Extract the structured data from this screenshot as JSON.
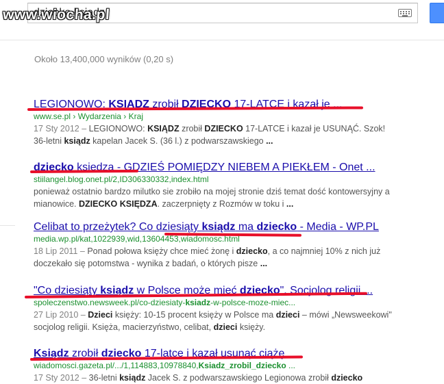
{
  "search": {
    "query": "dziecko ksiądz"
  },
  "watermark": {
    "text": "www.wiocha.pl"
  },
  "stats": {
    "text": "Około 13,400,000 wyników (0,20 s)"
  },
  "colors": {
    "link": "#1a0dab",
    "url_green": "#1a8f2e",
    "snippet_gray": "#545454",
    "accent_red": "#e8102a",
    "search_blue": "#4d90fe"
  },
  "icons": {
    "keyboard": "keyboard-icon",
    "search": "search-icon"
  },
  "results": [
    {
      "title": [
        {
          "t": "LEGIONOWO: ",
          "b": false
        },
        {
          "t": "KSIĄDZ",
          "b": true
        },
        {
          "t": " zrobił ",
          "b": false
        },
        {
          "t": "DZIECKO",
          "b": true
        },
        {
          "t": " 17-LATCE i kazał je ...",
          "b": false
        }
      ],
      "url": [
        {
          "t": "www.se.pl",
          "sep": false
        },
        {
          "t": " › ",
          "sep": true
        },
        {
          "t": "Wydarzenia",
          "sep": false
        },
        {
          "t": " › ",
          "sep": true
        },
        {
          "t": "Kraj",
          "sep": false
        }
      ],
      "snippet": [
        {
          "t": "17 Sty 2012 – ",
          "c": "date"
        },
        {
          "t": "LEGIONOWO: ",
          "c": ""
        },
        {
          "t": "KSIĄDZ",
          "c": "b"
        },
        {
          "t": " zrobił ",
          "c": ""
        },
        {
          "t": "DZIECKO",
          "c": "b"
        },
        {
          "t": " 17-LATCE i kazał je USUNĄĆ. Szok! 36-letni ",
          "c": ""
        },
        {
          "t": "ksiądz",
          "c": "b"
        },
        {
          "t": " kapelan Jacek S. (36 l.) z podwarszawskiego ",
          "c": ""
        },
        {
          "t": "...",
          "c": "b"
        }
      ]
    },
    {
      "title": [
        {
          "t": "dziecko",
          "b": true
        },
        {
          "t": " ksiedza - GDZIEŚ POMIĘDZY NIEBEM A PIEKŁEM - Onet ...",
          "b": false
        }
      ],
      "url": [
        {
          "t": "stiilangel.blog.onet.pl/2,ID306330332,index.html",
          "sep": false
        }
      ],
      "snippet": [
        {
          "t": "ponieważ ostatnio bardzo milutko sie zrobiło na mojej stronie dziś temat dość kontowersyjny a mianowice. ",
          "c": ""
        },
        {
          "t": "DZIECKO",
          "c": "b"
        },
        {
          "t": " ",
          "c": ""
        },
        {
          "t": "KSIĘDZA",
          "c": "b"
        },
        {
          "t": ". zaczerpnięty z Rozmów w toku i ",
          "c": ""
        },
        {
          "t": "...",
          "c": "b"
        }
      ]
    },
    {
      "title": [
        {
          "t": "Celibat to przeżytek? Co dziesiąty ",
          "b": false
        },
        {
          "t": "ksiądz",
          "b": true
        },
        {
          "t": " ma ",
          "b": false
        },
        {
          "t": "dziecko",
          "b": true
        },
        {
          "t": " - Media - WP.PL",
          "b": false
        }
      ],
      "url": [
        {
          "t": "media.wp.pl/kat,1022939,wid,13604453,wiadomosc.html",
          "sep": false
        }
      ],
      "snippet": [
        {
          "t": "18 Lip 2011 – ",
          "c": "date"
        },
        {
          "t": "Ponad połowa księży chce mieć żonę i ",
          "c": ""
        },
        {
          "t": "dziecko",
          "c": "b"
        },
        {
          "t": ", a co najmniej 10% z nich już doczekało się potomstwa - wynika z badań, o których pisze ",
          "c": ""
        },
        {
          "t": "...",
          "c": "b"
        }
      ]
    },
    {
      "title": [
        {
          "t": "\"Co dziesiąty ",
          "b": false
        },
        {
          "t": "ksiądz",
          "b": true
        },
        {
          "t": " w Polsce może mieć ",
          "b": false
        },
        {
          "t": "dziecko",
          "b": true
        },
        {
          "t": "\". Socjolog religii ...",
          "b": false
        }
      ],
      "url": [
        {
          "t": "spoleczenstwo.newsweek.pl/co-dziesiaty-",
          "sep": false
        },
        {
          "t": "ksiadz",
          "sep": false,
          "b": true
        },
        {
          "t": "-w-polsce-moze-miec...",
          "sep": false
        }
      ],
      "snippet": [
        {
          "t": "27 Lip 2010 – ",
          "c": "date"
        },
        {
          "t": "Dzieci",
          "c": "b"
        },
        {
          "t": " księży: 10-15 procent księży w Polsce ma ",
          "c": ""
        },
        {
          "t": "dzieci",
          "c": "b"
        },
        {
          "t": " – mówi „Newsweekowi\" socjolog religii. Księża, macierzyństwo, celibat, ",
          "c": ""
        },
        {
          "t": "dzieci",
          "c": "b"
        },
        {
          "t": " księży.",
          "c": ""
        }
      ]
    },
    {
      "title": [
        {
          "t": "Ksiądz",
          "b": true
        },
        {
          "t": " zrobił ",
          "b": false
        },
        {
          "t": "dziecko",
          "b": true
        },
        {
          "t": " 17-latce i kazał usunąć ciążę",
          "b": false
        }
      ],
      "url": [
        {
          "t": "wiadomosci.gazeta.pl/.../1,114883,10978840,",
          "sep": false
        },
        {
          "t": "Ksiadz_zrobil_dziecko",
          "sep": false,
          "b": true
        },
        {
          "t": " ...",
          "sep": false
        }
      ],
      "snippet": [
        {
          "t": "17 Sty 2012 – ",
          "c": "date"
        },
        {
          "t": "36-letni ",
          "c": ""
        },
        {
          "t": "ksiądz",
          "c": "b"
        },
        {
          "t": " Jacek S. z podwarszawskiego Legionowa zrobił ",
          "c": ""
        },
        {
          "t": "dziecko",
          "c": "b"
        }
      ]
    }
  ]
}
